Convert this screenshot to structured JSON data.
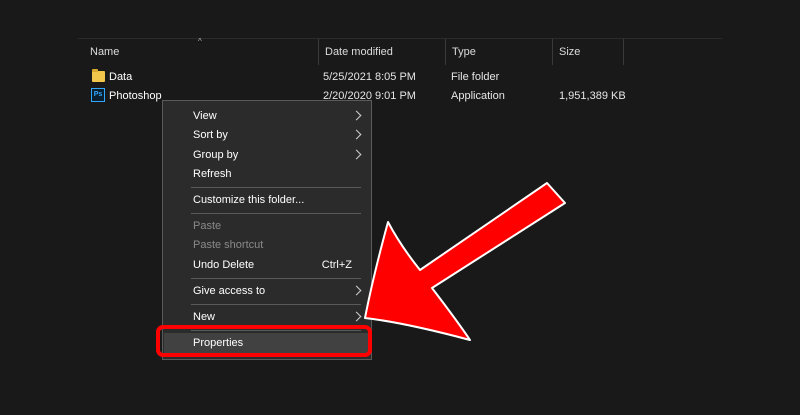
{
  "columns": {
    "name": "Name",
    "date": "Date modified",
    "type": "Type",
    "size": "Size",
    "sort_indicator": "^"
  },
  "files": [
    {
      "name": "Data",
      "date": "5/25/2021 8:05 PM",
      "type": "File folder",
      "size": "",
      "icon": "folder-icon"
    },
    {
      "name": "Photoshop",
      "date": "2/20/2020 9:01 PM",
      "type": "Application",
      "size": "1,951,389 KB",
      "icon": "photoshop-app-icon",
      "icon_text": "Ps"
    }
  ],
  "context_menu": {
    "view": "View",
    "sort_by": "Sort by",
    "group_by": "Group by",
    "refresh": "Refresh",
    "customize": "Customize this folder...",
    "paste": "Paste",
    "paste_shortcut": "Paste shortcut",
    "undo_delete": "Undo Delete",
    "undo_shortcut": "Ctrl+Z",
    "give_access": "Give access to",
    "new": "New",
    "properties": "Properties"
  },
  "colors": {
    "annotation": "#ff0000",
    "background": "#191919",
    "menu_bg": "#2b2b2b"
  }
}
